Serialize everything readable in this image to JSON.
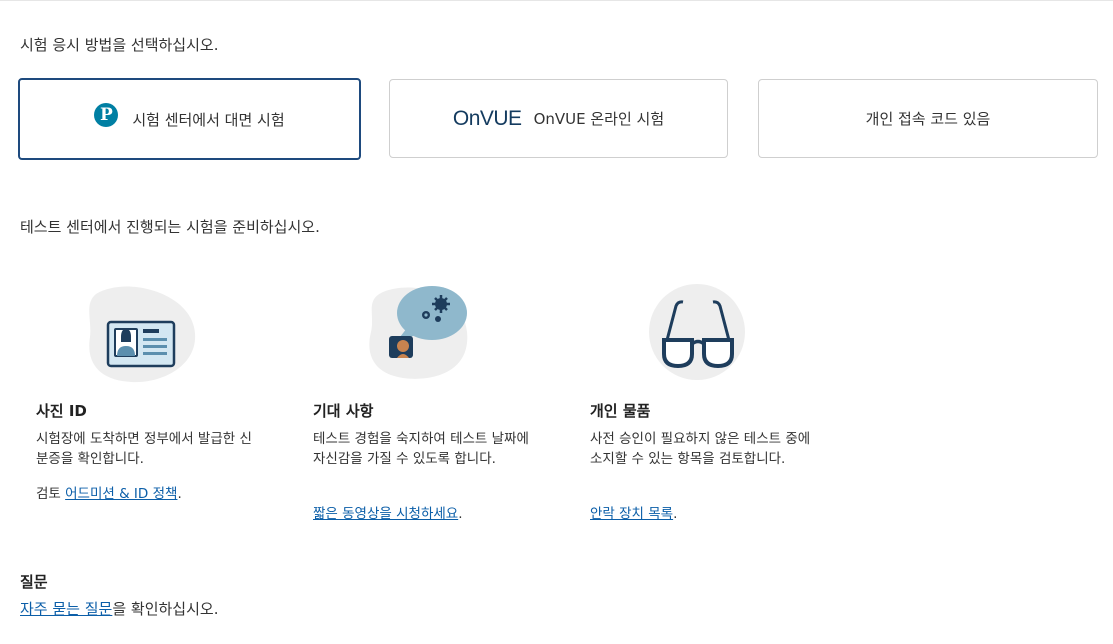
{
  "heading": "시험 응시 방법을 선택하십시오.",
  "options": [
    {
      "label": "시험 센터에서 대면 시험",
      "icon": "pearson-logo-icon",
      "selected": true
    },
    {
      "logo_text": "OnVUE",
      "label": "OnVUE 온라인 시험",
      "icon": "onvue-logo-icon",
      "selected": false
    },
    {
      "label": "개인 접속 코드 있음",
      "selected": false
    }
  ],
  "prep_heading": "테스트 센터에서 진행되는 시험을 준비하십시오.",
  "cards": [
    {
      "icon": "id-card-icon",
      "title": "사진 ID",
      "desc": "시험장에 도착하면 정부에서 발급한 신분증을 확인합니다.",
      "link_prefix": "검토 ",
      "link_text": "어드미션 & ID 정책",
      "link_suffix": "."
    },
    {
      "icon": "person-thinking-gears-icon",
      "title": "기대 사항",
      "desc": "테스트 경험을 숙지하여 테스트 날짜에 자신감을 가질 수 있도록 합니다.",
      "link_prefix": "",
      "link_text": "짧은 동영상을 시청하세요",
      "link_suffix": "."
    },
    {
      "icon": "glasses-icon",
      "title": "개인 물품",
      "desc": "사전 승인이 필요하지 않은 테스트 중에 소지할 수 있는 항목을 검토합니다.",
      "link_prefix": "",
      "link_text": "안락 장치 목록",
      "link_suffix": "."
    }
  ],
  "questions": {
    "title": "질문",
    "link_text": "자주 묻는 질문",
    "suffix": "을 확인하십시오."
  },
  "colors": {
    "selected_border": "#1e4a7e",
    "link": "#0b5ea8",
    "pearson_blue": "#007fa3",
    "onvue_navy": "#143b5f"
  }
}
